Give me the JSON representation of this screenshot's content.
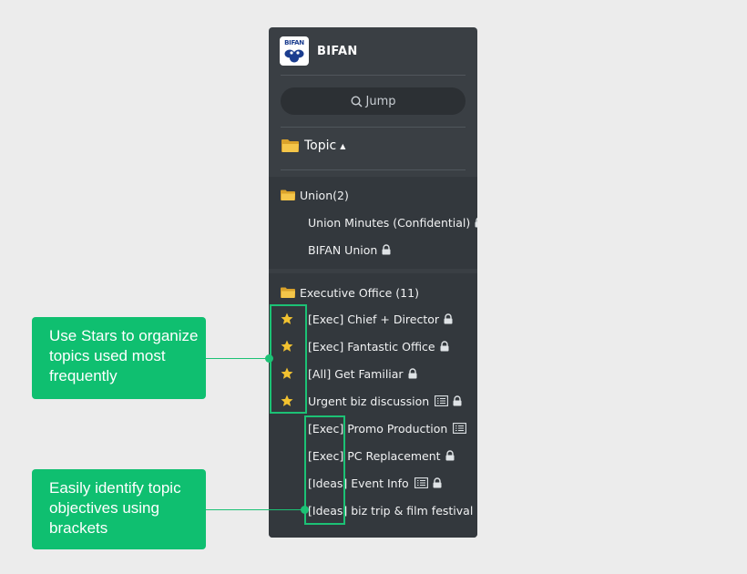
{
  "brand": {
    "name": "BIFAN",
    "logo_text": "BIFAN"
  },
  "jump": {
    "label": "Jump"
  },
  "topic_header": {
    "label": "Topic"
  },
  "groups": [
    {
      "label": "Union(2)",
      "items": [
        {
          "label": "Union Minutes (Confidential)",
          "starred": false,
          "locked": true,
          "doc": false
        },
        {
          "label": "BIFAN Union",
          "starred": false,
          "locked": true,
          "doc": false
        }
      ]
    },
    {
      "label": "Executive Office (11)",
      "items": [
        {
          "label": "[Exec] Chief + Director",
          "starred": true,
          "locked": true,
          "doc": false
        },
        {
          "label": "[Exec] Fantastic Office",
          "starred": true,
          "locked": true,
          "doc": false
        },
        {
          "label": "[All] Get Familiar",
          "starred": true,
          "locked": true,
          "doc": false
        },
        {
          "label": "Urgent biz discussion",
          "starred": true,
          "locked": true,
          "doc": true
        },
        {
          "label": "[Exec] Promo Production",
          "starred": false,
          "locked": false,
          "doc": true
        },
        {
          "label": "[Exec] PC Replacement",
          "starred": false,
          "locked": true,
          "doc": false
        },
        {
          "label": "[Ideas] Event Info",
          "starred": false,
          "locked": true,
          "doc": true
        },
        {
          "label": "[Ideas] biz trip & film festival",
          "starred": false,
          "locked": true,
          "doc": false
        }
      ]
    }
  ],
  "callouts": {
    "stars": {
      "lines": [
        "Use Stars to organize",
        "topics used most",
        "frequently"
      ]
    },
    "brackets": {
      "lines": [
        "Easily identify topic",
        "objectives using",
        "brackets"
      ]
    }
  },
  "colors": {
    "panel": "#3a3f44",
    "accent": "#1cc175",
    "callout": "#0fbf70",
    "star": "#f2c230",
    "folder": "#f4c64a"
  }
}
